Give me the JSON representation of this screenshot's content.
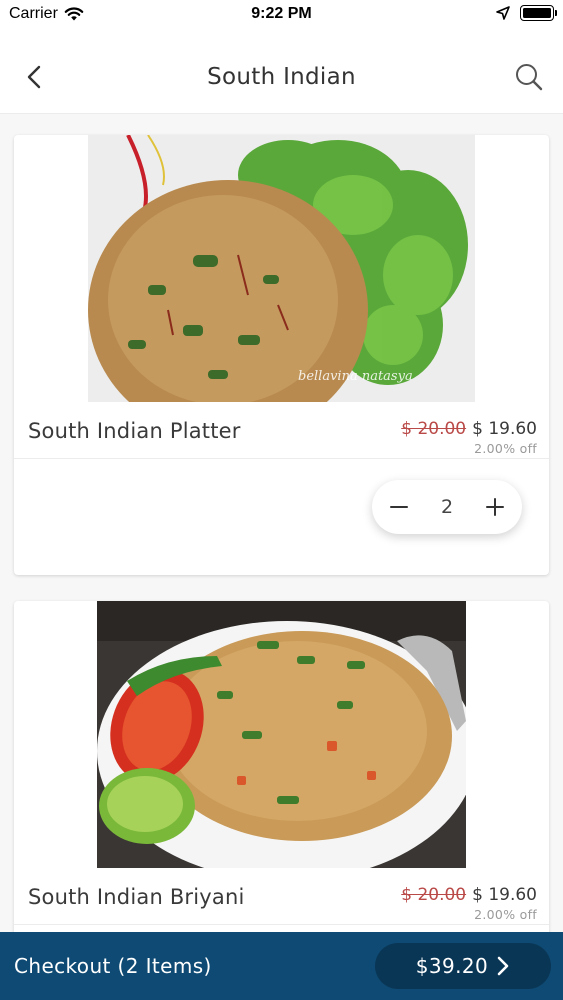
{
  "status": {
    "carrier": "Carrier",
    "time": "9:22 PM"
  },
  "nav": {
    "title": "South Indian"
  },
  "items": [
    {
      "name": "South Indian Platter",
      "old_price": "$ 20.00",
      "price": "$ 19.60",
      "discount": "2.00% off",
      "quantity": "2",
      "watermark": "bellavina natasya"
    },
    {
      "name": "South Indian Briyani",
      "old_price": "$ 20.00",
      "price": "$ 19.60",
      "discount": "2.00% off"
    }
  ],
  "checkout": {
    "label": "Checkout (2 Items)",
    "total": "$39.20"
  },
  "colors": {
    "checkout_bar": "#0e4a73",
    "checkout_pill": "#0a3656",
    "strike_price": "#b94a48"
  }
}
